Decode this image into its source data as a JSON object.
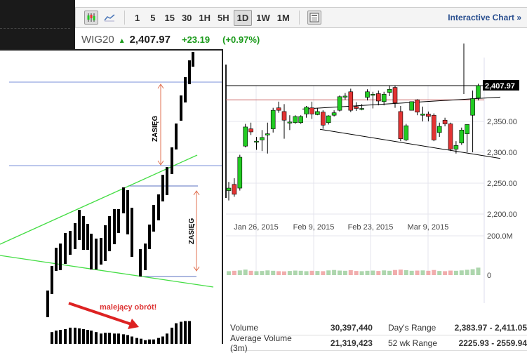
{
  "toolbar": {
    "intervals": [
      "1",
      "5",
      "15",
      "30",
      "1H",
      "5H",
      "1D",
      "1W",
      "1M"
    ],
    "active_interval": "1D",
    "interactive_chart": "Interactive Chart »"
  },
  "quote": {
    "symbol": "WIG20",
    "price": "2,407.97",
    "change": "+23.19",
    "change_pct": "(+0.97%)"
  },
  "colors": {
    "up": "#22cc22",
    "down": "#e33333",
    "accent": "#2a4f8f"
  },
  "annotation": {
    "range_label_1": "ZASIĘG",
    "range_label_2": "ZASIĘG",
    "volume_note": "malejący obrót!"
  },
  "chart_data": {
    "type": "candlestick",
    "x_ticks": [
      "Jan 26, 2015",
      "Feb 9, 2015",
      "Feb 23, 2015",
      "Mar 9, 2015"
    ],
    "y_ticks": [
      "2,350.00",
      "2,300.00",
      "2,250.00",
      "2,200.00"
    ],
    "y_range": [
      2180,
      2420
    ],
    "last_price_label": "2,407.97",
    "volume_ticks": [
      "200.0M",
      "0"
    ],
    "ohlc": [
      [
        2238,
        2252,
        2222,
        2242
      ],
      [
        2248,
        2258,
        2228,
        2232
      ],
      [
        2242,
        2296,
        2238,
        2292
      ],
      [
        2310,
        2346,
        2308,
        2341
      ],
      [
        2338,
        2348,
        2328,
        2333
      ],
      [
        2318,
        2325,
        2304,
        2318
      ],
      [
        2320,
        2336,
        2302,
        2324
      ],
      [
        2328,
        2348,
        2298,
        2330
      ],
      [
        2338,
        2372,
        2332,
        2368
      ],
      [
        2372,
        2382,
        2364,
        2368
      ],
      [
        2366,
        2378,
        2322,
        2352
      ],
      [
        2348,
        2360,
        2336,
        2349
      ],
      [
        2348,
        2360,
        2346,
        2358
      ],
      [
        2348,
        2360,
        2346,
        2358
      ],
      [
        2362,
        2375,
        2356,
        2373
      ],
      [
        2372,
        2382,
        2354,
        2362
      ],
      [
        2361,
        2372,
        2360,
        2366
      ],
      [
        2365,
        2368,
        2338,
        2344
      ],
      [
        2348,
        2360,
        2345,
        2359
      ],
      [
        2360,
        2368,
        2358,
        2364
      ],
      [
        2368,
        2392,
        2366,
        2390
      ],
      [
        2390,
        2396,
        2385,
        2391
      ],
      [
        2398,
        2403,
        2365,
        2368
      ],
      [
        2374,
        2381,
        2367,
        2371
      ],
      [
        2370,
        2378,
        2368,
        2371
      ],
      [
        2389,
        2402,
        2384,
        2398
      ],
      [
        2394,
        2398,
        2371,
        2394
      ],
      [
        2395,
        2400,
        2376,
        2383
      ],
      [
        2382,
        2398,
        2376,
        2394
      ],
      [
        2397,
        2408,
        2391,
        2402
      ],
      [
        2405,
        2408,
        2372,
        2380
      ],
      [
        2366,
        2375,
        2318,
        2322
      ],
      [
        2320,
        2346,
        2318,
        2343
      ],
      [
        2368,
        2380,
        2368,
        2382
      ],
      [
        2385,
        2386,
        2360,
        2365
      ],
      [
        2360,
        2374,
        2350,
        2362
      ],
      [
        2362,
        2366,
        2350,
        2358
      ],
      [
        2360,
        2363,
        2318,
        2320
      ],
      [
        2332,
        2348,
        2325,
        2342
      ],
      [
        2352,
        2356,
        2342,
        2346
      ],
      [
        2346,
        2348,
        2302,
        2305
      ],
      [
        2305,
        2318,
        2298,
        2311
      ],
      [
        2315,
        2340,
        2312,
        2336
      ],
      [
        2330,
        2345,
        2300,
        2345
      ],
      [
        2360,
        2400,
        2300,
        2387
      ],
      [
        2388,
        2411,
        2384,
        2408
      ]
    ],
    "volume_millions": [
      20,
      22,
      24,
      28,
      22,
      20,
      21,
      24,
      22,
      20,
      19,
      21,
      23,
      22,
      20,
      22,
      21,
      20,
      24,
      26,
      23,
      22,
      25,
      21,
      20,
      22,
      23,
      21,
      24,
      22,
      26,
      28,
      25,
      22,
      23,
      24,
      22,
      26,
      21,
      20,
      23,
      22,
      24,
      27,
      30,
      38
    ]
  },
  "stats": {
    "volume_label": "Volume",
    "volume": "30,397,440",
    "days_range_label": "Day's Range",
    "days_range": "2,383.97 - 2,411.05",
    "avg_volume_label": "Average Volume (3m)",
    "avg_volume": "21,319,423",
    "wk52_label": "52 wk Range",
    "wk52": "2225.93 - 2559.94"
  }
}
